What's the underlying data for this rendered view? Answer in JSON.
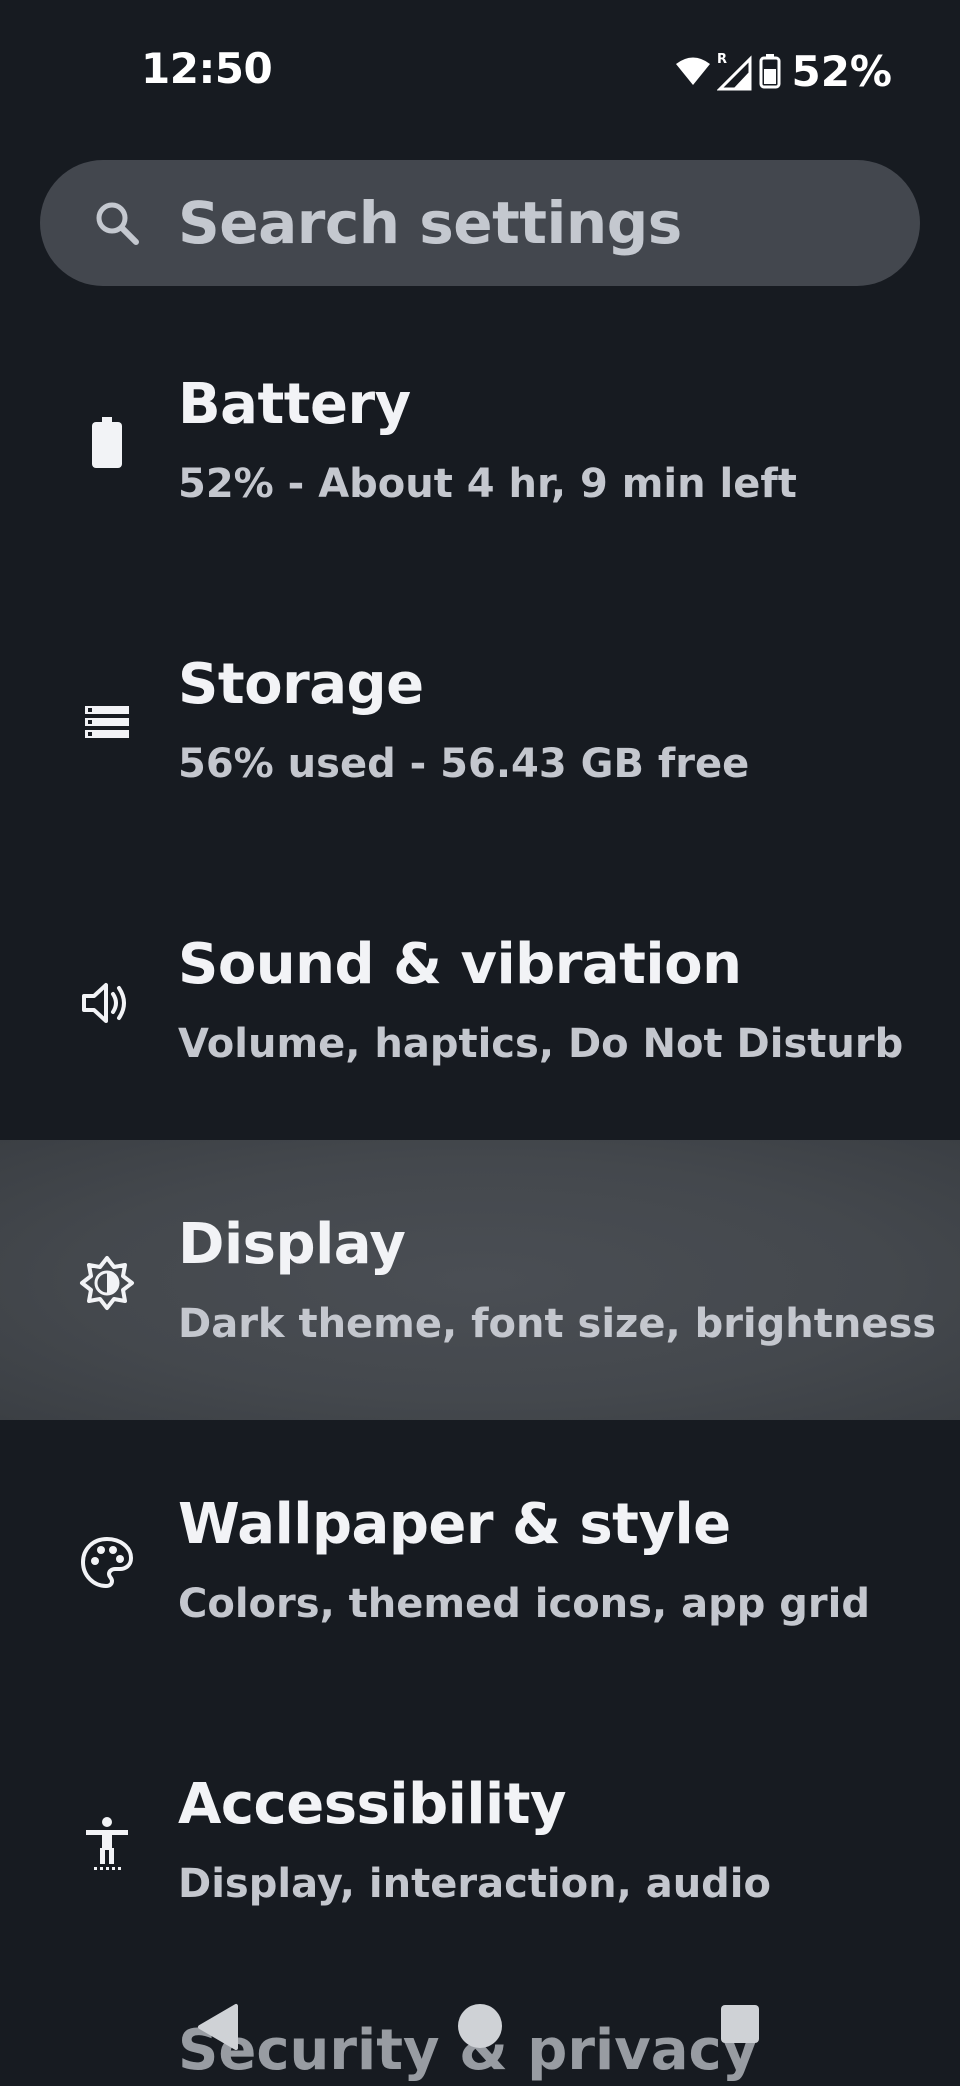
{
  "status_bar": {
    "time": "12:50",
    "battery_percent": "52%",
    "icons": [
      "wifi-icon",
      "signal-roaming-icon",
      "battery-icon"
    ]
  },
  "search": {
    "placeholder": "Search settings",
    "icon": "search-icon"
  },
  "items": [
    {
      "title": "Battery",
      "subtitle": "52% - About 4 hr, 9 min left",
      "icon": "battery-icon"
    },
    {
      "title": "Storage",
      "subtitle": "56% used - 56.43 GB free",
      "icon": "storage-icon"
    },
    {
      "title": "Sound & vibration",
      "subtitle": "Volume, haptics, Do Not Disturb",
      "icon": "speaker-icon"
    },
    {
      "title": "Display",
      "subtitle": "Dark theme, font size, brightness",
      "icon": "brightness-icon",
      "selected": true
    },
    {
      "title": "Wallpaper & style",
      "subtitle": "Colors, themed icons, app grid",
      "icon": "palette-icon"
    },
    {
      "title": "Accessibility",
      "subtitle": "Display, interaction, audio",
      "icon": "accessibility-icon"
    }
  ],
  "partial_item": {
    "title": "Security & privacy"
  },
  "nav_bar": {
    "buttons": [
      "back-icon",
      "home-icon",
      "recents-icon"
    ]
  },
  "colors": {
    "background": "#171b21",
    "search_bg": "#43474e",
    "selected_bg": "#44484d"
  }
}
